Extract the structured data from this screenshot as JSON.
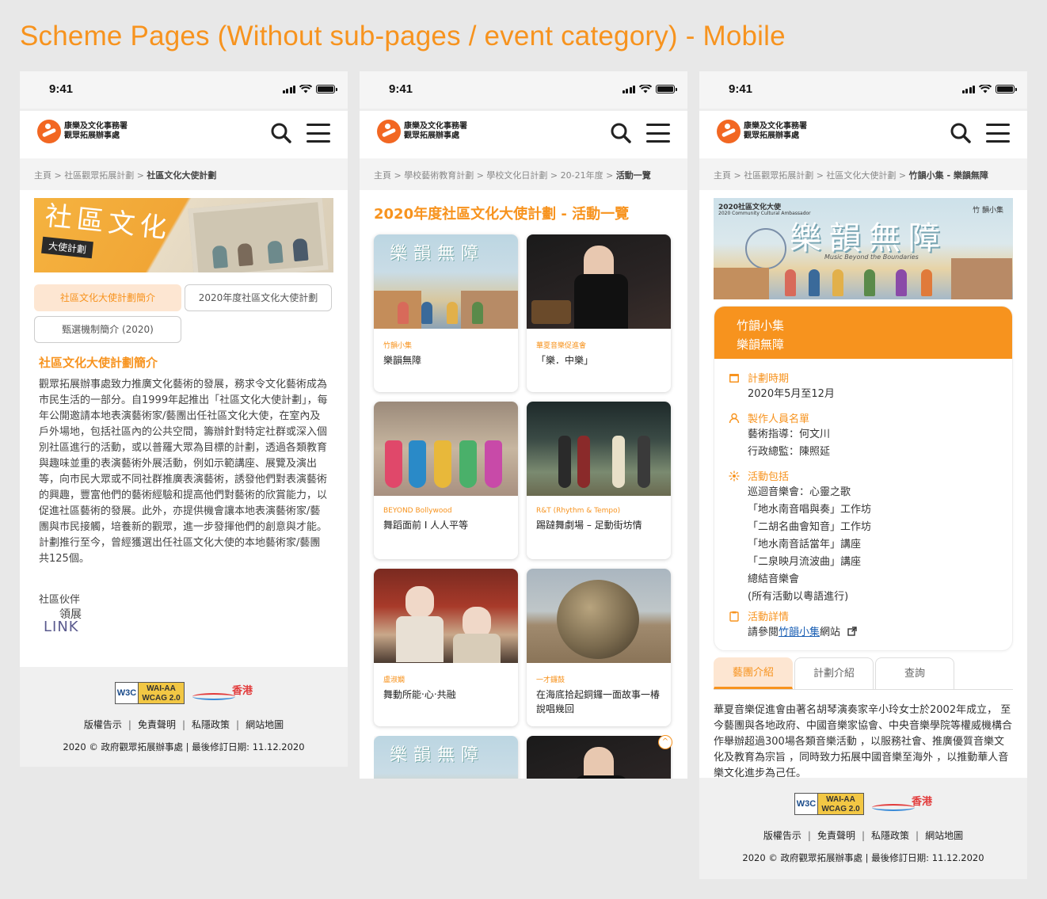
{
  "page_title": "Scheme Pages (Without sub-pages / event category) - Mobile",
  "status": {
    "time": "9:41"
  },
  "logo": {
    "line1": "康樂及文化事務署",
    "line2": "觀眾拓展辦事處"
  },
  "footer": {
    "links": [
      "版權告示",
      "免責聲明",
      "私隱政策",
      "網站地圖"
    ],
    "separator": "|",
    "copyright": "2020 © 政府觀眾拓展辦事處 | 最後修訂日期: 11.12.2020",
    "w3c_left": "W3C",
    "w3c_right_1": "WAI-AA",
    "w3c_right_2": "WCAG 2.0",
    "brand_hk": "香港"
  },
  "screen1": {
    "crumb_prefix": "主頁 > 社區觀眾拓展計劃 > ",
    "crumb_current": "社區文化大使計劃",
    "banner_title": "社區文化",
    "banner_sub": "大使計劃",
    "tabs": [
      "社區文化大使計劃簡介",
      "2020年度社區文化大使計劃",
      "甄選機制簡介 (2020)"
    ],
    "heading": "社區文化大使計劃簡介",
    "body": "觀眾拓展辦事處致力推廣文化藝術的發展，務求令文化藝術成為市民生活的一部分。自1999年起推出「社區文化大使計劃」，每年公開邀請本地表演藝術家/藝團出任社區文化大使，在室內及戶外場地，包括社區內的公共空間，籌辦針對特定社群或深入個別社區進行的活動，或以普羅大眾為目標的計劃，透過各類教育與趣味並重的表演藝術外展活動，例如示範講座、展覽及演出等，向市民大眾或不同社群推廣表演藝術，誘發他們對表演藝術的興趣，豐富他們的藝術經驗和提高他們對藝術的欣賞能力，以促進社區藝術的發展。此外，亦提供機會讓本地表演藝術家/藝團與市民接觸，培養新的觀眾，進一步發揮他們的創意與才能。計劃推行至今，曾經獲選出任社區文化大使的本地藝術家/藝團共125個。",
    "partner_label": "社區伙伴",
    "partner_logo_1": "領展",
    "partner_logo_2": "LINK"
  },
  "screen2": {
    "crumb_prefix": "主頁 > 學校藝術教育計劃 > 學校文化日計劃 > 20-21年度 > ",
    "crumb_current": "活動一覽",
    "heading": "2020年度社區文化大使計劃 - 活動一覽",
    "img_text_a": "樂韻無障",
    "cards": [
      {
        "category": "竹韻小集",
        "name": "樂韻無障"
      },
      {
        "category": "華夏音樂促進會",
        "name": "「樂．中樂」"
      },
      {
        "category": "BEYOND Bollywood",
        "name": "舞蹈面前 I 人人平等"
      },
      {
        "category": "R&T (Rhythm & Tempo)",
        "name": "踢躂舞劇場 – 足動街坊情"
      },
      {
        "category": "盧淑嫻",
        "name": "舞動所能‧心‧共融"
      },
      {
        "category": "一才鑼鼓",
        "name": "在海底拾起銅鑼一面故事一椿說唱幾回"
      }
    ],
    "up_icon": "^"
  },
  "screen3": {
    "crumb_prefix": "主頁 > 社區觀眾拓展計劃 > 社區文化大使計劃 > ",
    "crumb_current": "竹韻小集 - 樂韻無障",
    "banner_title": "樂韻無障",
    "banner_s1": "2020社區文化大使",
    "banner_s2": "2020 Community Cultural Ambassador",
    "banner_s3": "竹 韻小集",
    "banner_s4": "Music Beyond the Boundaries",
    "org": "竹韻小集",
    "event": "樂韻無障",
    "sections": {
      "period_label": "計劃時期",
      "period": "2020年5月至12月",
      "crew_label": "製作人員名單",
      "crew": [
        "藝術指導：何文川",
        "行政總監：陳照延"
      ],
      "activities_label": "活動包括",
      "activities": [
        "巡迴音樂會：心靈之歌",
        "「地水南音唱與奏」工作坊",
        "「二胡名曲會知音」工作坊",
        "「地水南音話當年」講座",
        "「二泉映月流波曲」講座",
        "總結音樂會",
        "(所有活動以粵語進行)"
      ],
      "details_label": "活動詳情",
      "details_prefix": "請參閱",
      "details_link": "竹韻小集",
      "details_suffix": "網站"
    },
    "tabs": [
      "藝團介紹",
      "計劃介紹",
      "查詢"
    ],
    "body": "華夏音樂促進會由著名胡琴演奏家辛小玲女士於2002年成立， 至今藝團與各地政府、中國音樂家協會、中央音樂學院等權威機構合作舉辦超過300場各類音樂活動 ，以服務社會、推廣優質音樂文化及教育為宗旨 ，同時致力拓展中國音樂至海外 ，以推動華人音樂文化進步為己任。",
    "up_icon": "^"
  },
  "colors": {
    "accent": "#f7931e",
    "tab_bg": "#fde6d2",
    "link": "#1a5fb4"
  },
  "icons": [
    "search-icon",
    "menu-icon",
    "calendar-icon",
    "person-icon",
    "sparkle-icon",
    "clipboard-icon",
    "external-link-icon",
    "back-to-top-icon"
  ]
}
